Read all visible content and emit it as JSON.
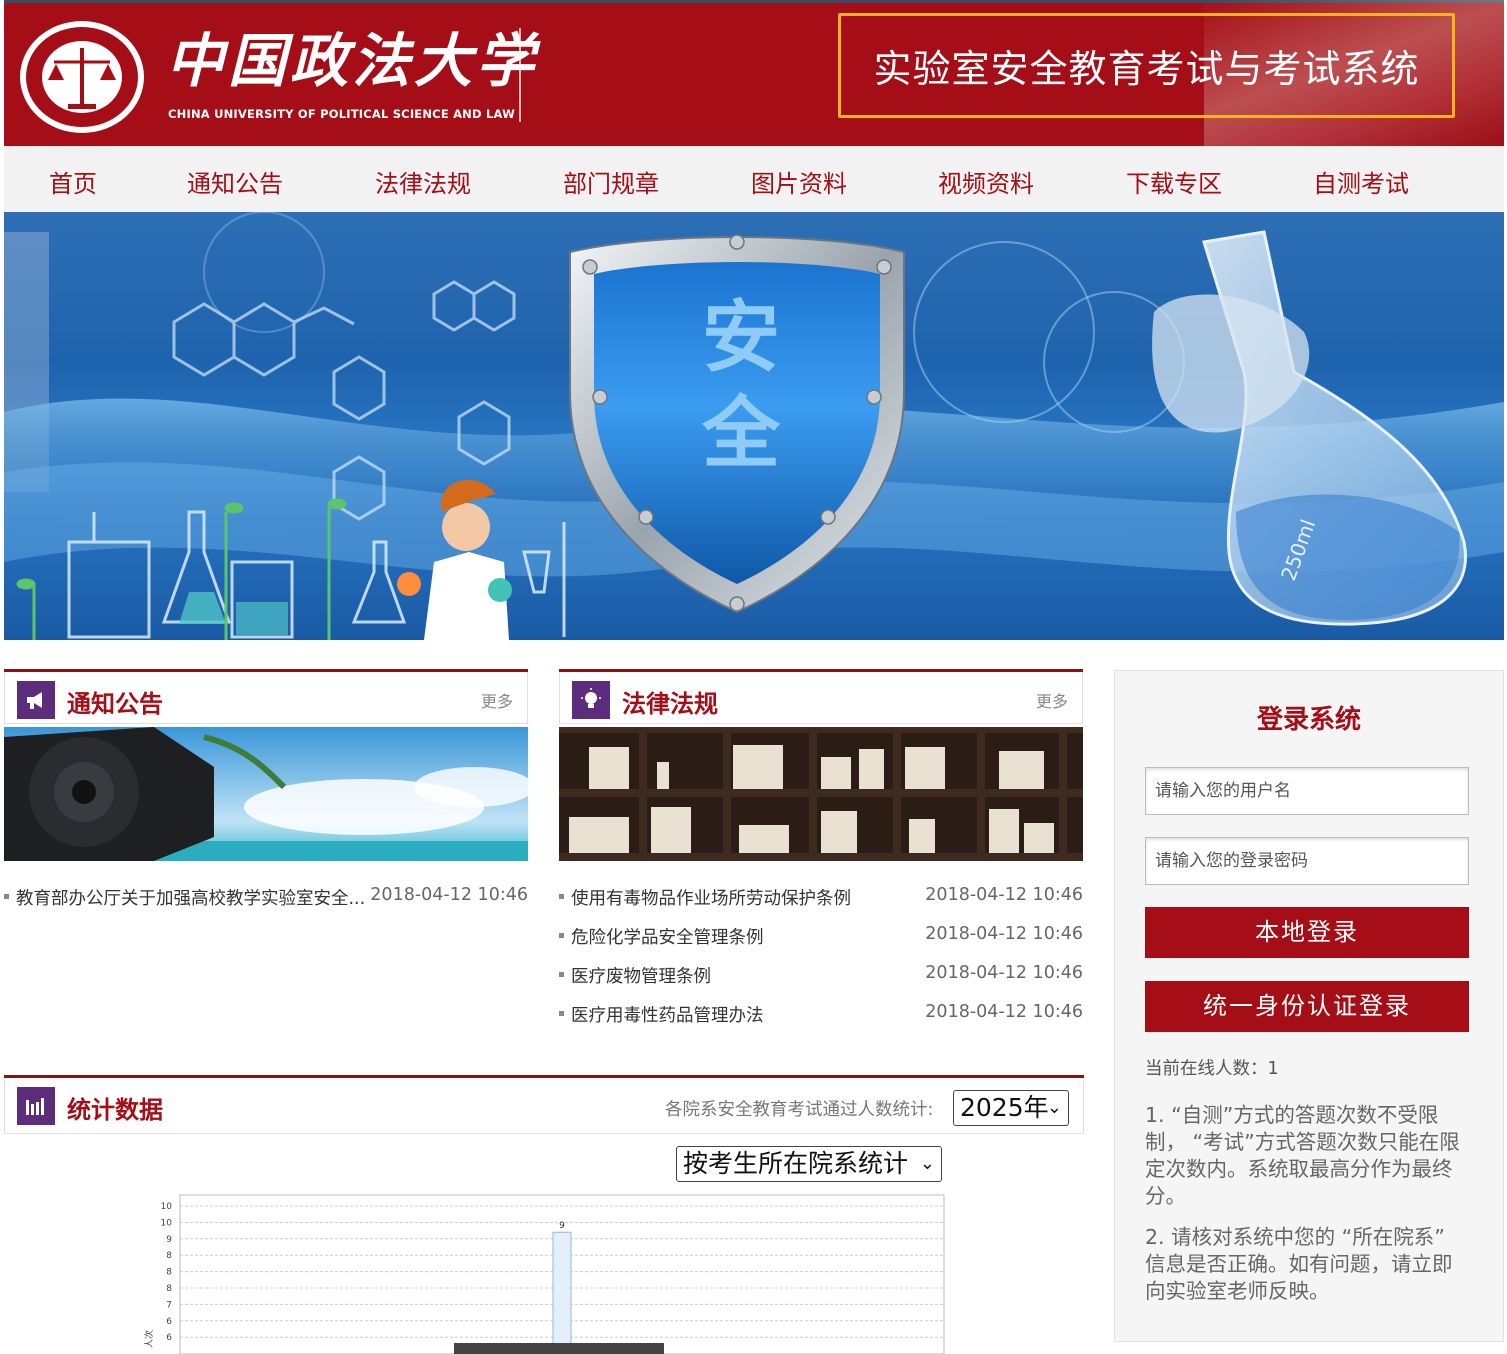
{
  "header": {
    "logo_cn": "中国政法大学",
    "logo_en": "CHINA UNIVERSITY OF POLITICAL SCIENCE AND LAW",
    "system_title": "实验室安全教育考试与考试系统"
  },
  "nav": {
    "items": [
      {
        "label": "首页"
      },
      {
        "label": "通知公告"
      },
      {
        "label": "法律法规"
      },
      {
        "label": "部门规章"
      },
      {
        "label": "图片资料"
      },
      {
        "label": "视频资料"
      },
      {
        "label": "下载专区"
      },
      {
        "label": "自测考试"
      }
    ]
  },
  "banner": {
    "shield_text_1": "安",
    "shield_text_2": "全",
    "flask_text": "250ml"
  },
  "notices": {
    "title": "通知公告",
    "more": "更多",
    "items": [
      {
        "title": "教育部办公厅关于加强高校教学实验室安全...",
        "date": "2018-04-12 10:46"
      }
    ]
  },
  "laws": {
    "title": "法律法规",
    "more": "更多",
    "items": [
      {
        "title": "使用有毒物品作业场所劳动保护条例",
        "date": "2018-04-12 10:46"
      },
      {
        "title": "危险化学品安全管理条例",
        "date": "2018-04-12 10:46"
      },
      {
        "title": "医疗废物管理条例",
        "date": "2018-04-12 10:46"
      },
      {
        "title": "医疗用毒性药品管理办法",
        "date": "2018-04-12 10:46"
      }
    ]
  },
  "stats": {
    "title": "统计数据",
    "label": "各院系安全教育考试通过人数统计:",
    "year_selected": "2025年",
    "group_by_selected": "按考生所在院系统计"
  },
  "chart_data": {
    "type": "bar",
    "y_tick_labels": [
      "10",
      "10",
      "9",
      "8",
      "8",
      "8",
      "7",
      "6",
      "6"
    ],
    "ylabel": "人次",
    "series": [
      {
        "values": [
          9
        ]
      }
    ],
    "data_labels": [
      "9"
    ],
    "ylim": [
      0,
      10
    ],
    "grid": true
  },
  "login": {
    "title": "登录系统",
    "username_placeholder": "请输入您的用户名",
    "password_placeholder": "请输入您的登录密码",
    "local_login": "本地登录",
    "sso_login": "统一身份认证登录",
    "online_count": "当前在线人数：1",
    "note1": "1. “自测”方式的答题次数不受限制， “考试”方式答题次数只能在限定次数内。系统取最高分作为最终分。",
    "note2": "2. 请核对系统中您的 “所在院系” 信息是否正确。如有问题，请立即向实验室老师反映。"
  },
  "colors": {
    "brand_red": "#a50e16",
    "accent_gold": "#f2b51d",
    "icon_purple": "#5b2d7c"
  }
}
